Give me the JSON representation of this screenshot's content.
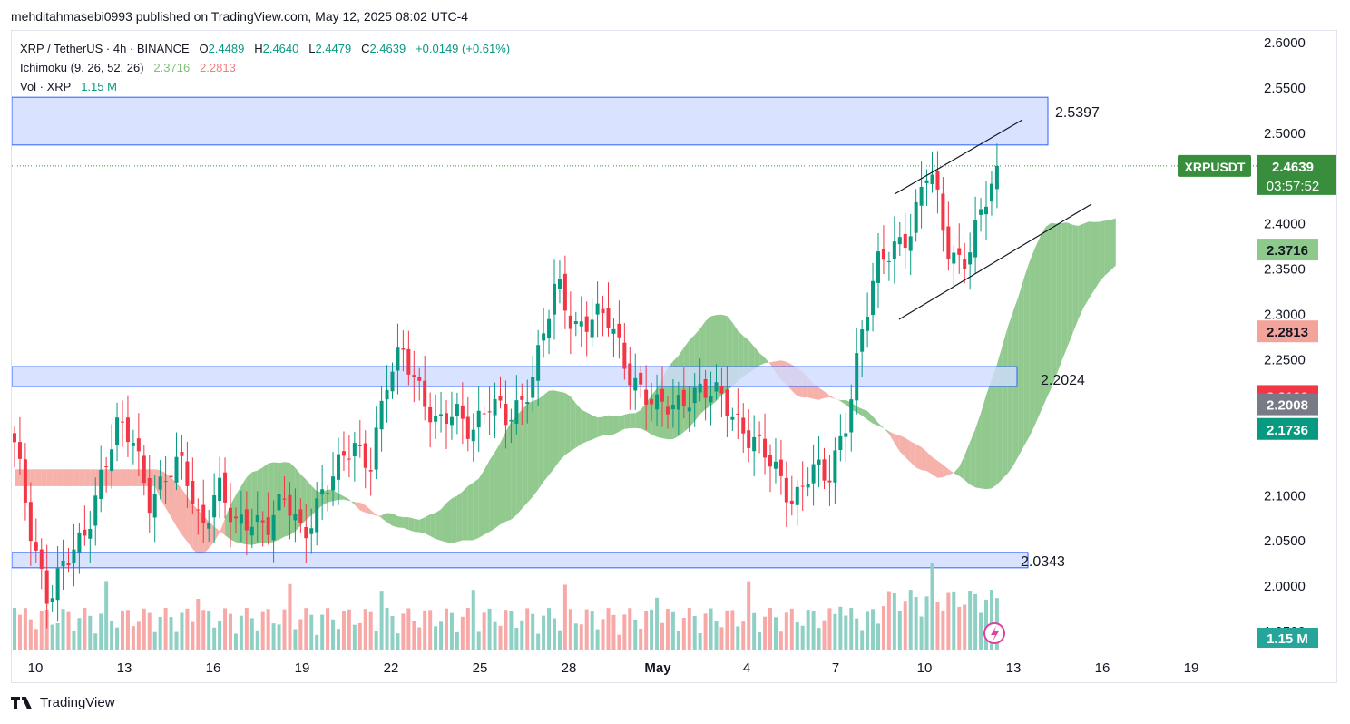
{
  "publisher_line": "mehditahmasebi0993 published on TradingView.com, May 12, 2025 08:02 UTC-4",
  "legend": {
    "symbol": "XRP / TetherUS · 4h · BINANCE",
    "o_label": "O",
    "o": "2.4489",
    "h_label": "H",
    "h": "2.4640",
    "l_label": "L",
    "l": "2.4479",
    "c_label": "C",
    "c": "2.4639",
    "change": "+0.0149 (+0.61%)",
    "ichimoku_label": "Ichimoku (9, 26, 52, 26)",
    "ichimoku_v1": "2.3716",
    "ichimoku_v2": "2.2813",
    "vol_label": "Vol · XRP",
    "vol_value": "1.15 M"
  },
  "footer_brand": "TradingView",
  "colors": {
    "up": "#089981",
    "down": "#f23645",
    "cloud_bull": "#7fbf7b",
    "cloud_bear": "#f4a39b",
    "zone": "#cfdcff",
    "zone_border": "#2962ff",
    "price_tag": "#388e3c"
  },
  "chart_data": {
    "type": "candlestick",
    "symbol_tag": "XRPUSDT",
    "last_price": "2.4639",
    "countdown": "03:57:52",
    "ylim": [
      1.93,
      2.61
    ],
    "y_ticks": [
      "2.6000",
      "2.5500",
      "2.5000",
      "2.4000",
      "2.3500",
      "2.3000",
      "2.2500",
      "2.1000",
      "2.0500",
      "2.0000",
      "1.9500"
    ],
    "x_ticks": [
      "10",
      "13",
      "16",
      "19",
      "22",
      "25",
      "28",
      "May",
      "4",
      "7",
      "10",
      "13",
      "16",
      "19"
    ],
    "price_badges": [
      {
        "label": "2.3716",
        "value": 2.3716,
        "color": "#8cc98a",
        "text": "#131722"
      },
      {
        "label": "2.2813",
        "value": 2.2813,
        "color": "#f4a39b",
        "text": "#131722"
      },
      {
        "label": "2.2100",
        "value": 2.21,
        "color": "#f23645",
        "text": "#ffffff"
      },
      {
        "label": "2.2008",
        "value": 2.2008,
        "color": "#787b86",
        "text": "#ffffff"
      },
      {
        "label": "2.1736",
        "value": 2.1736,
        "color": "#089981",
        "text": "#ffffff"
      }
    ],
    "volume_badge": "1.15 M",
    "zones": [
      {
        "label": "2.5397",
        "top": 2.5397,
        "bottom": 2.487
      },
      {
        "label": "2.2024",
        "top": 2.2424,
        "bottom": 2.2204
      },
      {
        "label": "2.0343",
        "top": 2.0373,
        "bottom": 2.0203
      }
    ],
    "close_path": [
      2.15,
      2.06,
      1.99,
      2.02,
      2.05,
      2.12,
      2.17,
      2.16,
      2.1,
      2.12,
      2.13,
      2.07,
      2.11,
      2.06,
      2.08,
      2.07,
      2.09,
      2.06,
      2.1,
      2.12,
      2.16,
      2.14,
      2.22,
      2.26,
      2.22,
      2.17,
      2.19,
      2.18,
      2.2,
      2.18,
      2.21,
      2.26,
      2.33,
      2.29,
      2.3,
      2.29,
      2.25,
      2.22,
      2.19,
      2.2,
      2.22,
      2.21,
      2.2,
      2.18,
      2.15,
      2.12,
      2.1,
      2.13,
      2.11,
      2.18,
      2.28,
      2.35,
      2.38,
      2.4,
      2.46,
      2.38,
      2.36,
      2.4,
      2.46
    ],
    "notes": "Close path is a set of approximate anchor closes read off the axis; the page draws candles between them."
  }
}
